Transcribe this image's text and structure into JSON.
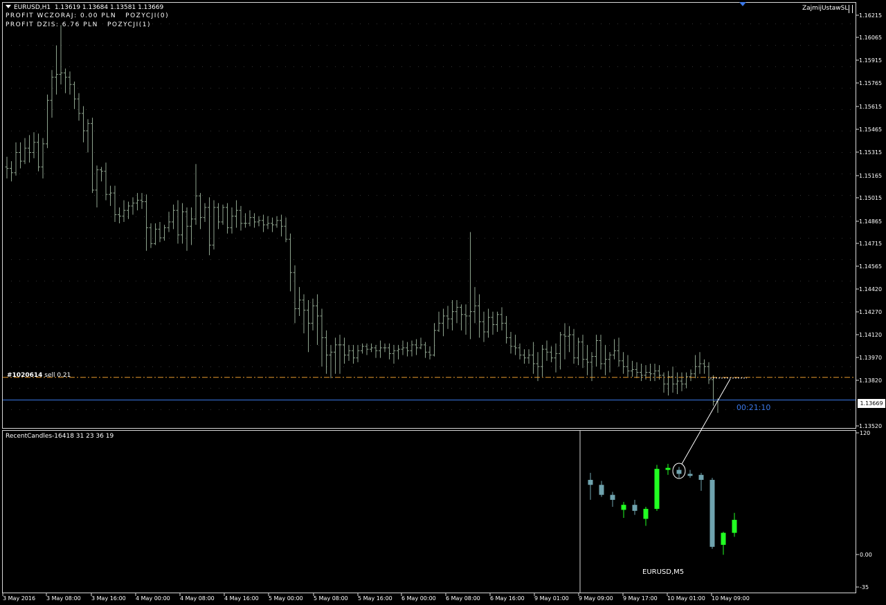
{
  "header": {
    "symbol_line": "EURUSD,H1  1.13619 1.13684 1.13581 1.13669",
    "profit_yesterday": "PROFIT WCZORAJ: 0.00 PLN   POZYCJI(0)",
    "profit_today": "PROFIT DZIS: 6.76 PLN   POZYCJI(1)",
    "expert_name": "ZajmijUstawSL"
  },
  "order_line": {
    "ticket": "#1020614",
    "rest": " sell 0.21",
    "price": 1.13826
  },
  "bid_line": {
    "price": 1.13669,
    "label": "1.13669"
  },
  "timer": "00:21:10",
  "colors": {
    "background": "#000000",
    "bars": "#8fa58f",
    "order_line": "#e89a2c",
    "bid_line": "#3b78e7",
    "bull_candle": "#22ff22",
    "bear_candle": "#6fa3ae",
    "grid_dots": "#333333"
  },
  "price_axis": {
    "ticks": [
      "1.16215",
      "1.16065",
      "1.15915",
      "1.15765",
      "1.15615",
      "1.15465",
      "1.15315",
      "1.15165",
      "1.15015",
      "1.14865",
      "1.14715",
      "1.14565",
      "1.14420",
      "1.14270",
      "1.14120",
      "1.13970",
      "1.13820",
      "1.13520"
    ]
  },
  "time_axis": {
    "labels": [
      "3 May 2016",
      "3 May 08:00",
      "3 May 16:00",
      "4 May 00:00",
      "4 May 08:00",
      "4 May 16:00",
      "5 May 00:00",
      "5 May 08:00",
      "5 May 16:00",
      "6 May 00:00",
      "6 May 08:00",
      "6 May 16:00",
      "9 May 01:00",
      "9 May 09:00",
      "9 May 17:00",
      "10 May 01:00",
      "10 May 09:00"
    ]
  },
  "indicator": {
    "label": "RecentCandles-16418 31 23 36 19",
    "inner_label": "EURUSD,M5",
    "axis_labels": [
      "120",
      "0.00",
      "-35"
    ]
  },
  "chart_data": {
    "type": "ohlc",
    "symbol": "EURUSD",
    "timeframe": "H1",
    "ylim": [
      1.1349,
      1.163
    ],
    "bars": [
      [
        1.1528,
        1.1535,
        1.152,
        1.1527
      ],
      [
        1.1527,
        1.1532,
        1.1518,
        1.1524
      ],
      [
        1.1524,
        1.1545,
        1.1522,
        1.1538
      ],
      [
        1.1538,
        1.1545,
        1.1527,
        1.1532
      ],
      [
        1.1532,
        1.1548,
        1.153,
        1.1541
      ],
      [
        1.1541,
        1.155,
        1.1531,
        1.1538
      ],
      [
        1.1538,
        1.1552,
        1.1534,
        1.1545
      ],
      [
        1.1545,
        1.1551,
        1.1525,
        1.1528
      ],
      [
        1.1528,
        1.1548,
        1.152,
        1.1544
      ],
      [
        1.1544,
        1.1578,
        1.1541,
        1.1574
      ],
      [
        1.1574,
        1.1595,
        1.1562,
        1.159
      ],
      [
        1.159,
        1.1612,
        1.1578,
        1.1592
      ],
      [
        1.1592,
        1.1626,
        1.1585,
        1.1593
      ],
      [
        1.1593,
        1.1596,
        1.1579,
        1.159
      ],
      [
        1.159,
        1.1594,
        1.1578,
        1.1585
      ],
      [
        1.1585,
        1.1587,
        1.1568,
        1.1575
      ],
      [
        1.1575,
        1.1579,
        1.156,
        1.1565
      ],
      [
        1.1565,
        1.157,
        1.1545,
        1.1553
      ],
      [
        1.1553,
        1.1561,
        1.1538,
        1.1558
      ],
      [
        1.1558,
        1.1562,
        1.151,
        1.1512
      ],
      [
        1.1512,
        1.1529,
        1.15,
        1.1526
      ],
      [
        1.1526,
        1.1528,
        1.1518,
        1.1525
      ],
      [
        1.1525,
        1.1531,
        1.1505,
        1.1509
      ],
      [
        1.1509,
        1.1515,
        1.1501,
        1.151
      ],
      [
        1.151,
        1.1515,
        1.149,
        1.1495
      ],
      [
        1.1495,
        1.15,
        1.1489,
        1.1494
      ],
      [
        1.1494,
        1.1505,
        1.149,
        1.1498
      ],
      [
        1.1498,
        1.1504,
        1.1492,
        1.1501
      ],
      [
        1.1501,
        1.1507,
        1.1495,
        1.1503
      ],
      [
        1.1503,
        1.151,
        1.1498,
        1.1505
      ],
      [
        1.1505,
        1.151,
        1.1499,
        1.1504
      ],
      [
        1.1504,
        1.1509,
        1.147,
        1.1486
      ],
      [
        1.1486,
        1.1489,
        1.1472,
        1.1475
      ],
      [
        1.1475,
        1.1489,
        1.1474,
        1.1485
      ],
      [
        1.1485,
        1.149,
        1.1476,
        1.1479
      ],
      [
        1.1479,
        1.1488,
        1.1477,
        1.1486
      ],
      [
        1.1486,
        1.1497,
        1.1483,
        1.149
      ],
      [
        1.149,
        1.1502,
        1.1485,
        1.1498
      ],
      [
        1.1498,
        1.1505,
        1.1475,
        1.1481
      ],
      [
        1.1481,
        1.1503,
        1.1475,
        1.1497
      ],
      [
        1.1497,
        1.15,
        1.147,
        1.1487
      ],
      [
        1.1487,
        1.15,
        1.1474,
        1.1492
      ],
      [
        1.1492,
        1.153,
        1.1488,
        1.1508
      ],
      [
        1.1508,
        1.151,
        1.1485,
        1.1493
      ],
      [
        1.1493,
        1.1503,
        1.149,
        1.15
      ],
      [
        1.15,
        1.1507,
        1.1467,
        1.1474
      ],
      [
        1.1474,
        1.1505,
        1.1471,
        1.15
      ],
      [
        1.15,
        1.1503,
        1.1485,
        1.149
      ],
      [
        1.149,
        1.1502,
        1.1488,
        1.15
      ],
      [
        1.15,
        1.1503,
        1.1482,
        1.1486
      ],
      [
        1.1486,
        1.15,
        1.1482,
        1.1494
      ],
      [
        1.1494,
        1.1505,
        1.1486,
        1.1498
      ],
      [
        1.1498,
        1.1501,
        1.1484,
        1.1489
      ],
      [
        1.1489,
        1.1496,
        1.1486,
        1.1489
      ],
      [
        1.1489,
        1.1498,
        1.1487,
        1.1493
      ],
      [
        1.1493,
        1.1496,
        1.1486,
        1.149
      ],
      [
        1.149,
        1.1494,
        1.1487,
        1.1491
      ],
      [
        1.1491,
        1.1495,
        1.1483,
        1.1488
      ],
      [
        1.1488,
        1.1494,
        1.1485,
        1.1489
      ],
      [
        1.1489,
        1.1493,
        1.1483,
        1.1488
      ],
      [
        1.1488,
        1.1494,
        1.1486,
        1.1491
      ],
      [
        1.1491,
        1.1495,
        1.148,
        1.1487
      ],
      [
        1.1487,
        1.1493,
        1.1476,
        1.1478
      ],
      [
        1.1478,
        1.1482,
        1.1442,
        1.1455
      ],
      [
        1.1455,
        1.146,
        1.142,
        1.143
      ],
      [
        1.143,
        1.1445,
        1.1425,
        1.1436
      ],
      [
        1.1436,
        1.144,
        1.1413,
        1.1429
      ],
      [
        1.1429,
        1.1436,
        1.14,
        1.142
      ],
      [
        1.142,
        1.1437,
        1.1415,
        1.1432
      ],
      [
        1.1432,
        1.144,
        1.1405,
        1.1425
      ],
      [
        1.1425,
        1.143,
        1.139,
        1.141
      ],
      [
        1.141,
        1.1415,
        1.1385,
        1.1398
      ],
      [
        1.1398,
        1.1405,
        1.1382,
        1.14
      ],
      [
        1.14,
        1.141,
        1.1385,
        1.1405
      ],
      [
        1.1405,
        1.1412,
        1.1385,
        1.1405
      ],
      [
        1.1405,
        1.141,
        1.1392,
        1.1398
      ],
      [
        1.1398,
        1.1405,
        1.1394,
        1.1401
      ],
      [
        1.1401,
        1.1405,
        1.1392,
        1.1396
      ],
      [
        1.1396,
        1.1405,
        1.1393,
        1.1401
      ],
      [
        1.1401,
        1.1406,
        1.1399,
        1.1404
      ],
      [
        1.1404,
        1.1406,
        1.1398,
        1.1402
      ],
      [
        1.1402,
        1.1406,
        1.14,
        1.1403
      ],
      [
        1.1403,
        1.1405,
        1.1396,
        1.1401
      ],
      [
        1.1401,
        1.1408,
        1.1396,
        1.1403
      ],
      [
        1.1403,
        1.1406,
        1.14,
        1.1403
      ],
      [
        1.1403,
        1.1406,
        1.1395,
        1.1399
      ],
      [
        1.1399,
        1.1405,
        1.1392,
        1.1401
      ],
      [
        1.1401,
        1.1405,
        1.1395,
        1.1402
      ],
      [
        1.1402,
        1.1408,
        1.1398,
        1.1403
      ],
      [
        1.1403,
        1.1407,
        1.1397,
        1.1401
      ],
      [
        1.1401,
        1.1408,
        1.1397,
        1.1405
      ],
      [
        1.1405,
        1.1409,
        1.1398,
        1.1403
      ],
      [
        1.1403,
        1.141,
        1.1402,
        1.1405
      ],
      [
        1.1405,
        1.1407,
        1.1396,
        1.14
      ],
      [
        1.14,
        1.1404,
        1.1395,
        1.1398
      ],
      [
        1.1398,
        1.142,
        1.1397,
        1.1415
      ],
      [
        1.1415,
        1.1428,
        1.1414,
        1.142
      ],
      [
        1.142,
        1.143,
        1.1411,
        1.1425
      ],
      [
        1.1425,
        1.1432,
        1.1416,
        1.1423
      ],
      [
        1.1423,
        1.1436,
        1.1415,
        1.1428
      ],
      [
        1.1428,
        1.1436,
        1.142,
        1.1431
      ],
      [
        1.1431,
        1.1433,
        1.1415,
        1.1426
      ],
      [
        1.1426,
        1.1433,
        1.1412,
        1.1425
      ],
      [
        1.1425,
        1.1483,
        1.1409,
        1.1428
      ],
      [
        1.1428,
        1.1445,
        1.142,
        1.1432
      ],
      [
        1.1432,
        1.144,
        1.141,
        1.1421
      ],
      [
        1.1421,
        1.1428,
        1.1407,
        1.1414
      ],
      [
        1.1414,
        1.143,
        1.141,
        1.1424
      ],
      [
        1.1424,
        1.1428,
        1.1412,
        1.1419
      ],
      [
        1.1419,
        1.1428,
        1.1414,
        1.1426
      ],
      [
        1.1426,
        1.1431,
        1.1415,
        1.142
      ],
      [
        1.142,
        1.1425,
        1.1406,
        1.141
      ],
      [
        1.141,
        1.1414,
        1.1399,
        1.1404
      ],
      [
        1.1404,
        1.1412,
        1.1398,
        1.1403
      ],
      [
        1.1403,
        1.1406,
        1.1395,
        1.1398
      ],
      [
        1.1398,
        1.1402,
        1.1392,
        1.1396
      ],
      [
        1.1396,
        1.1402,
        1.1392,
        1.1398
      ],
      [
        1.1398,
        1.1407,
        1.1385,
        1.1392
      ],
      [
        1.1392,
        1.14,
        1.138,
        1.139
      ],
      [
        1.139,
        1.1405,
        1.1383,
        1.1402
      ],
      [
        1.1402,
        1.1408,
        1.1394,
        1.14
      ],
      [
        1.14,
        1.1404,
        1.1393,
        1.1396
      ],
      [
        1.1396,
        1.1406,
        1.1386,
        1.1399
      ],
      [
        1.1399,
        1.1414,
        1.1388,
        1.1412
      ],
      [
        1.1412,
        1.142,
        1.1395,
        1.1411
      ],
      [
        1.1411,
        1.1418,
        1.14,
        1.1412
      ],
      [
        1.1412,
        1.1416,
        1.1392,
        1.1396
      ],
      [
        1.1396,
        1.141,
        1.1391,
        1.1407
      ],
      [
        1.1407,
        1.1412,
        1.1389,
        1.1395
      ],
      [
        1.1395,
        1.1405,
        1.1384,
        1.1393
      ],
      [
        1.1393,
        1.14,
        1.138,
        1.1397
      ],
      [
        1.1397,
        1.1412,
        1.139,
        1.1408
      ],
      [
        1.1408,
        1.1412,
        1.1388,
        1.1392
      ],
      [
        1.1392,
        1.1405,
        1.1384,
        1.1395
      ],
      [
        1.1395,
        1.14,
        1.1386,
        1.1398
      ],
      [
        1.1398,
        1.1409,
        1.1395,
        1.1401
      ],
      [
        1.1401,
        1.141,
        1.139,
        1.1394
      ],
      [
        1.1394,
        1.14,
        1.1385,
        1.139
      ],
      [
        1.139,
        1.1398,
        1.1383,
        1.1387
      ],
      [
        1.1387,
        1.1394,
        1.1383,
        1.1388
      ],
      [
        1.1388,
        1.1393,
        1.1382,
        1.1386
      ],
      [
        1.1386,
        1.1392,
        1.138,
        1.1384
      ],
      [
        1.1384,
        1.1391,
        1.1381,
        1.1386
      ],
      [
        1.1386,
        1.1392,
        1.138,
        1.1385
      ],
      [
        1.1385,
        1.1392,
        1.138,
        1.1387
      ],
      [
        1.1387,
        1.1391,
        1.1381,
        1.1384
      ],
      [
        1.1384,
        1.1386,
        1.1372,
        1.1378
      ],
      [
        1.1378,
        1.1387,
        1.137,
        1.1383
      ],
      [
        1.1383,
        1.139,
        1.1372,
        1.1378
      ],
      [
        1.1378,
        1.1386,
        1.1371,
        1.138
      ],
      [
        1.138,
        1.1386,
        1.1373,
        1.1378
      ],
      [
        1.1378,
        1.1386,
        1.1375,
        1.1383
      ],
      [
        1.1383,
        1.1388,
        1.138,
        1.1385
      ],
      [
        1.1385,
        1.1398,
        1.1382,
        1.139
      ],
      [
        1.139,
        1.14,
        1.1385,
        1.1392
      ],
      [
        1.1392,
        1.1395,
        1.1385,
        1.139
      ],
      [
        1.139,
        1.1393,
        1.1378,
        1.1381
      ],
      [
        1.1381,
        1.1384,
        1.1363,
        1.1366
      ],
      [
        1.1366,
        1.1368,
        1.1358,
        1.1367
      ]
    ],
    "sub_candles": [
      [
        75,
        82,
        55,
        70
      ],
      [
        70,
        74,
        58,
        60
      ],
      [
        60,
        63,
        48,
        55
      ],
      [
        45,
        53,
        37,
        50
      ],
      [
        50,
        55,
        40,
        44
      ],
      [
        36,
        48,
        29,
        46
      ],
      [
        46,
        90,
        44,
        86
      ],
      [
        85,
        91,
        80,
        87
      ],
      [
        85,
        88,
        77,
        81
      ],
      [
        81,
        85,
        77,
        79
      ],
      [
        80,
        82,
        64,
        75
      ],
      [
        75,
        77,
        6,
        8
      ],
      [
        10,
        23,
        0,
        22
      ],
      [
        22,
        42,
        18,
        35
      ]
    ]
  }
}
